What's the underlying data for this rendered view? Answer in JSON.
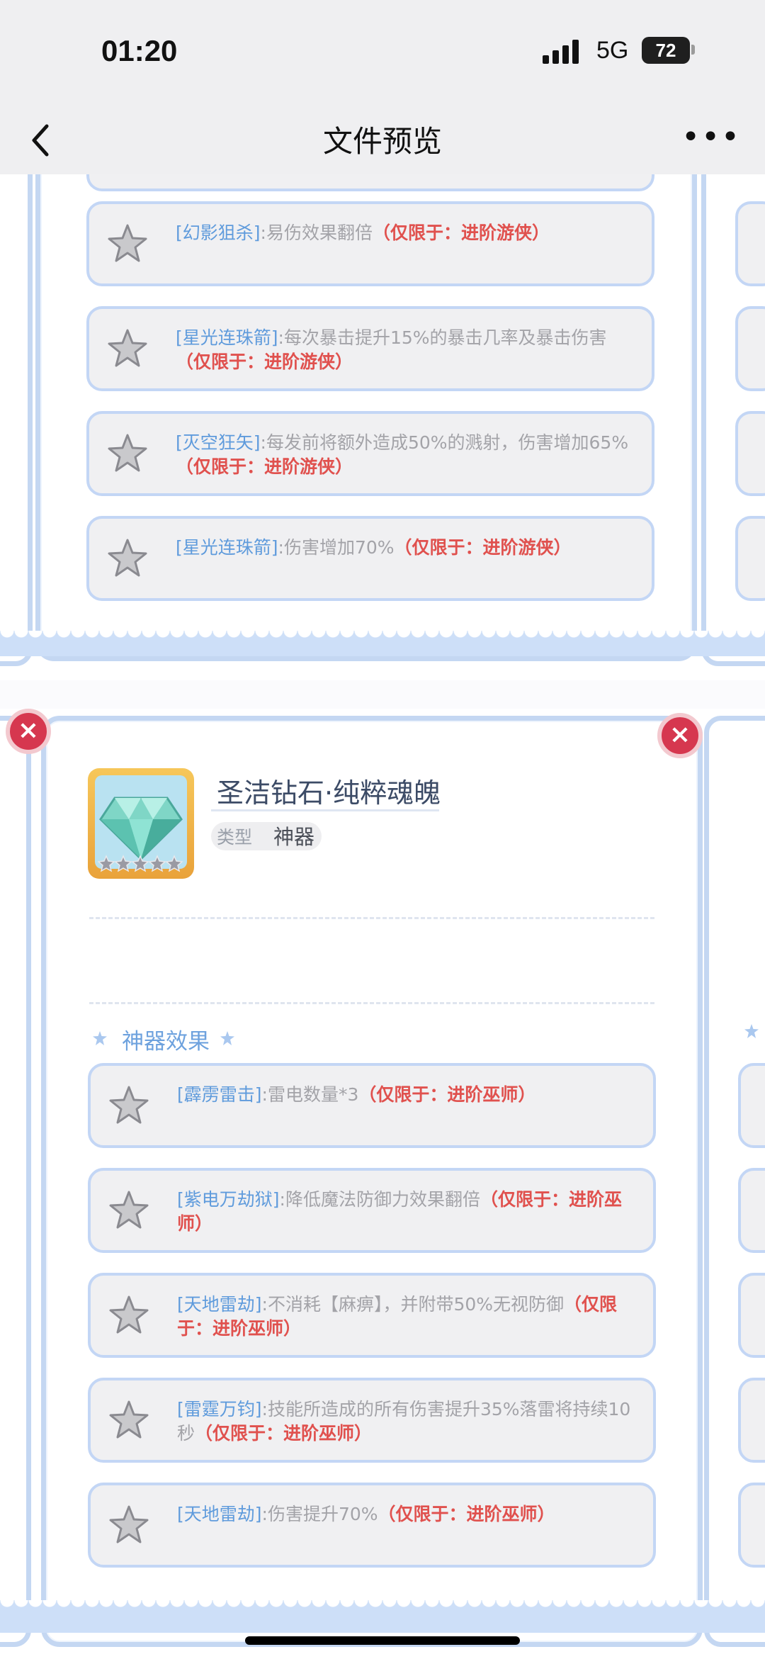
{
  "status_bar": {
    "time": "01:20",
    "network": "5G",
    "battery": "72"
  },
  "nav": {
    "title": "文件预览",
    "more": "•••"
  },
  "panel_top": {
    "effects": [
      {
        "name": "[幻影狙杀]",
        "desc": ":易伤效果翻倍",
        "limit": "（仅限于：进阶游侠）"
      },
      {
        "name": "[星光连珠箭]",
        "desc": ":每次暴击提升15%的暴击几率及暴击伤害",
        "limit": "（仅限于：进阶游侠）"
      },
      {
        "name": "[灭空狂矢]",
        "desc": ":每发前将额外造成50%的溅射，伤害增加65%",
        "limit": "（仅限于：进阶游侠）"
      },
      {
        "name": "[星光连珠箭]",
        "desc": ":伤害增加70%",
        "limit": "（仅限于：进阶游侠）"
      }
    ]
  },
  "panel_bottom": {
    "item_name": "圣洁钻石·纯粹魂魄",
    "type_label": "类型",
    "type_value": "神器",
    "section_title": "神器效果",
    "close_label": "×",
    "effects": [
      {
        "name": "[霹雳雷击]",
        "desc": ":雷电数量*3",
        "limit": "（仅限于：进阶巫师）"
      },
      {
        "name": "[紫电万劫狱]",
        "desc": ":降低魔法防御力效果翻倍",
        "limit": "（仅限于：进阶巫师）"
      },
      {
        "name": "[天地雷劫]",
        "desc": ":不消耗【麻痹】，并附带50%无视防御",
        "limit": "（仅限于：进阶巫师）"
      },
      {
        "name": "[雷霆万钧]",
        "desc": ":技能所造成的所有伤害提升35%落雷将持续10秒",
        "limit": "（仅限于：进阶巫师）"
      },
      {
        "name": "[天地雷劫]",
        "desc": ":伤害提升70%",
        "limit": "（仅限于：进阶巫师）"
      }
    ]
  },
  "colors": {
    "accent_blue": "#5f9bdc",
    "limit_red": "#e0514e",
    "frame_blue": "#c4d7f2"
  },
  "icons": [
    "back-chevron-icon",
    "more-icon",
    "signal-icon",
    "star-icon",
    "diamond-icon",
    "close-icon"
  ]
}
